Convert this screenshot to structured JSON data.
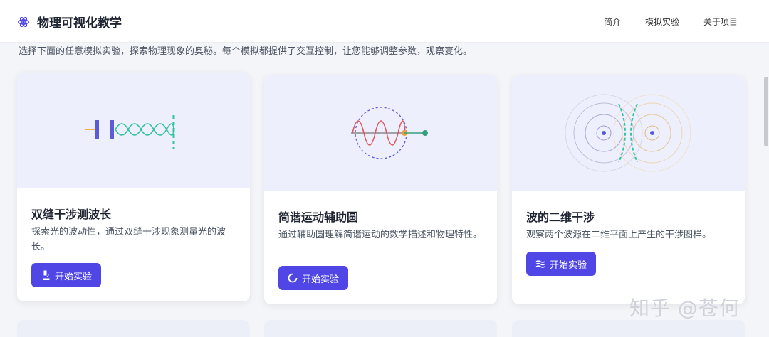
{
  "header": {
    "brand_icon": "atom-icon",
    "title": "物理可视化教学",
    "nav": [
      "简介",
      "模拟实验",
      "关于项目"
    ]
  },
  "intro": "选择下面的任意模拟实验，探索物理现象的奥秘。每个模拟都提供了交互控制，让您能够调整参数，观察变化。",
  "cards": [
    {
      "title": "双缝干涉测波长",
      "description": "探索光的波动性，通过双缝干涉现象测量光的波长。",
      "button_label": "开始实验",
      "button_icon": "microscope-icon"
    },
    {
      "title": "简谐运动辅助圆",
      "description": "通过辅助圆理解简谐运动的数学描述和物理特性。",
      "button_label": "开始实验",
      "button_icon": "circle-notch-icon"
    },
    {
      "title": "波的二维干涉",
      "description": "观察两个波源在二维平面上产生的干涉图样。",
      "button_label": "开始实验",
      "button_icon": "water-icon"
    }
  ],
  "watermark": "知乎 @苍何",
  "colors": {
    "accent": "#4f46e5",
    "card_visual_bg": "#eeeffd",
    "teal": "#34c3a0",
    "red_wave": "#e0575b",
    "orange": "#f0a030"
  }
}
